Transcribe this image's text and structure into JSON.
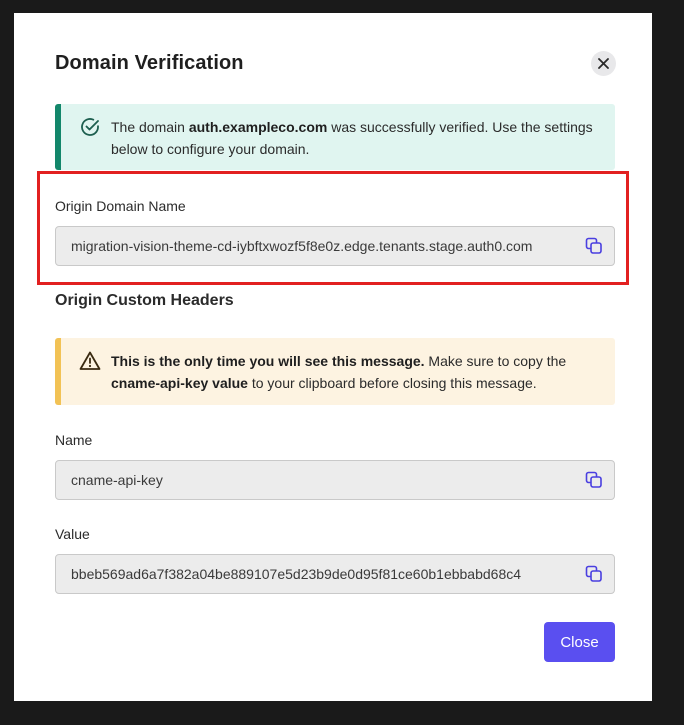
{
  "dialog": {
    "title": "Domain Verification",
    "close_icon": "close-icon"
  },
  "success_alert": {
    "icon": "check-circle-icon",
    "text_before": "The domain ",
    "domain": "auth.exampleco.com",
    "text_after": " was successfully verified. Use the settings below to configure your domain.",
    "accent_color": "#13876b"
  },
  "origin_domain": {
    "label": "Origin Domain Name",
    "value": "migration-vision-theme-cd-iybftxwozf5f8e0z.edge.tenants.stage.auth0.com",
    "copy_icon": "copy-icon"
  },
  "custom_headers": {
    "title": "Origin Custom Headers"
  },
  "warning_alert": {
    "icon": "warning-triangle-icon",
    "bold_lead": "This is the only time you will see this message.",
    "text_mid": " Make sure to copy the ",
    "bold_key": "cname-api-key value",
    "text_end": " to your clipboard before closing this message.",
    "accent_color": "#f2c255"
  },
  "header_name": {
    "label": "Name",
    "value": "cname-api-key",
    "copy_icon": "copy-icon"
  },
  "header_value": {
    "label": "Value",
    "value": "bbeb569ad6a7f382a04be889107e5d23b9de0d95f81ce60b1ebbabd68c4",
    "copy_icon": "copy-icon"
  },
  "footer": {
    "close_label": "Close",
    "button_color": "#5a4ff0"
  }
}
